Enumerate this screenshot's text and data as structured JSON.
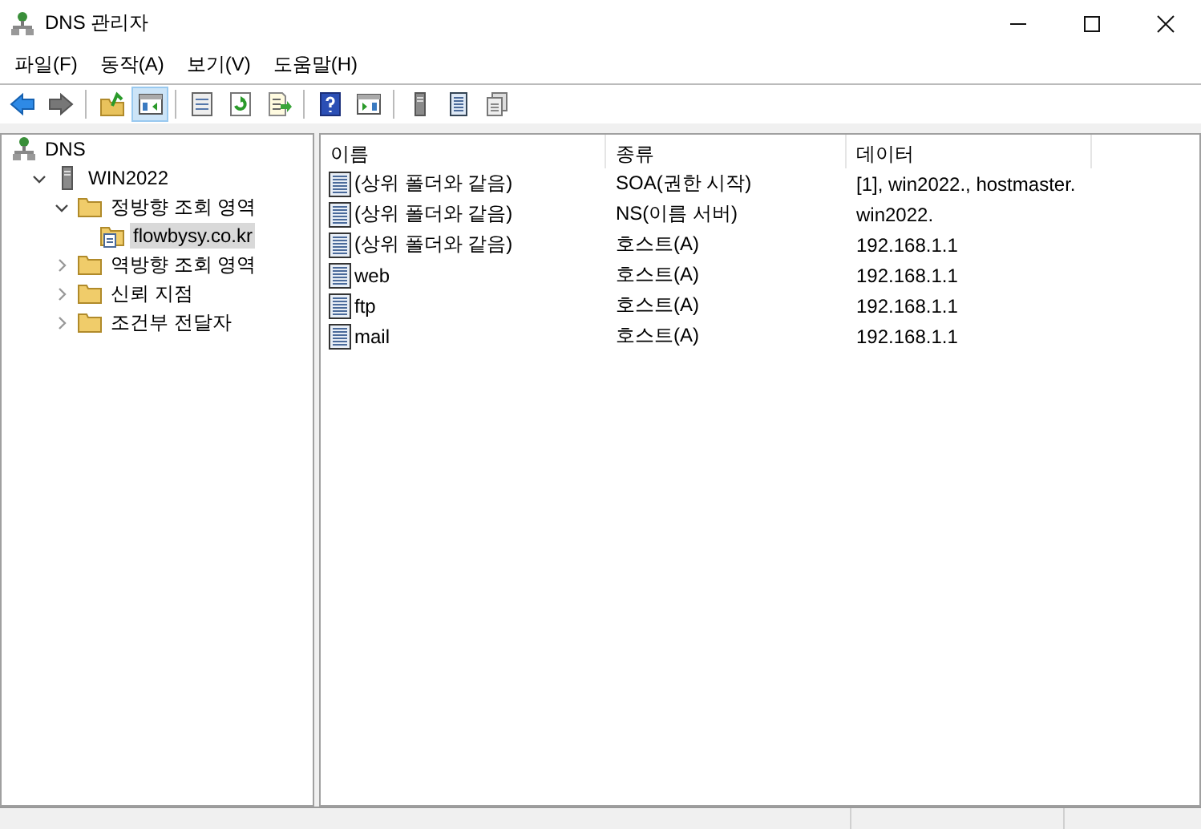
{
  "window": {
    "title": "DNS 관리자"
  },
  "menu": [
    "파일(F)",
    "동작(A)",
    "보기(V)",
    "도움말(H)"
  ],
  "toolbar": [
    {
      "kind": "back",
      "pressed": false
    },
    {
      "kind": "forward",
      "pressed": false
    },
    {
      "kind": "separator"
    },
    {
      "kind": "up",
      "pressed": false
    },
    {
      "kind": "tree",
      "pressed": true
    },
    {
      "kind": "separator"
    },
    {
      "kind": "properties",
      "pressed": false
    },
    {
      "kind": "refresh",
      "pressed": false
    },
    {
      "kind": "export",
      "pressed": false
    },
    {
      "kind": "separator"
    },
    {
      "kind": "help",
      "pressed": false
    },
    {
      "kind": "actionpane",
      "pressed": false
    },
    {
      "kind": "separator"
    },
    {
      "kind": "server",
      "pressed": false
    },
    {
      "kind": "list",
      "pressed": false
    },
    {
      "kind": "copy",
      "pressed": false
    }
  ],
  "tree": [
    {
      "label": "DNS",
      "kind": "root",
      "selected": false,
      "children": [
        {
          "label": "WIN2022",
          "kind": "server",
          "expanded": true,
          "selected": false,
          "children": [
            {
              "label": "정방향 조회 영역",
              "kind": "folder",
              "expanded": true,
              "selected": false,
              "children": [
                {
                  "label": "flowbysy.co.kr",
                  "kind": "zone",
                  "selected": true
                }
              ]
            },
            {
              "label": "역방향 조회 영역",
              "kind": "folder",
              "expanded": false,
              "selected": false
            },
            {
              "label": "신뢰 지점",
              "kind": "folder",
              "expanded": false,
              "selected": false
            },
            {
              "label": "조건부 전달자",
              "kind": "folder",
              "expanded": false,
              "selected": false
            }
          ]
        }
      ]
    }
  ],
  "table": {
    "columns": [
      "이름",
      "종류",
      "데이터"
    ],
    "rows": [
      {
        "name": "(상위 폴더와 같음)",
        "type": "SOA(권한 시작)",
        "data": "[1], win2022., hostmaster."
      },
      {
        "name": "(상위 폴더와 같음)",
        "type": "NS(이름 서버)",
        "data": "win2022."
      },
      {
        "name": "(상위 폴더와 같음)",
        "type": "호스트(A)",
        "data": "192.168.1.1"
      },
      {
        "name": "web",
        "type": "호스트(A)",
        "data": "192.168.1.1"
      },
      {
        "name": "ftp",
        "type": "호스트(A)",
        "data": "192.168.1.1"
      },
      {
        "name": "mail",
        "type": "호스트(A)",
        "data": "192.168.1.1"
      }
    ]
  }
}
